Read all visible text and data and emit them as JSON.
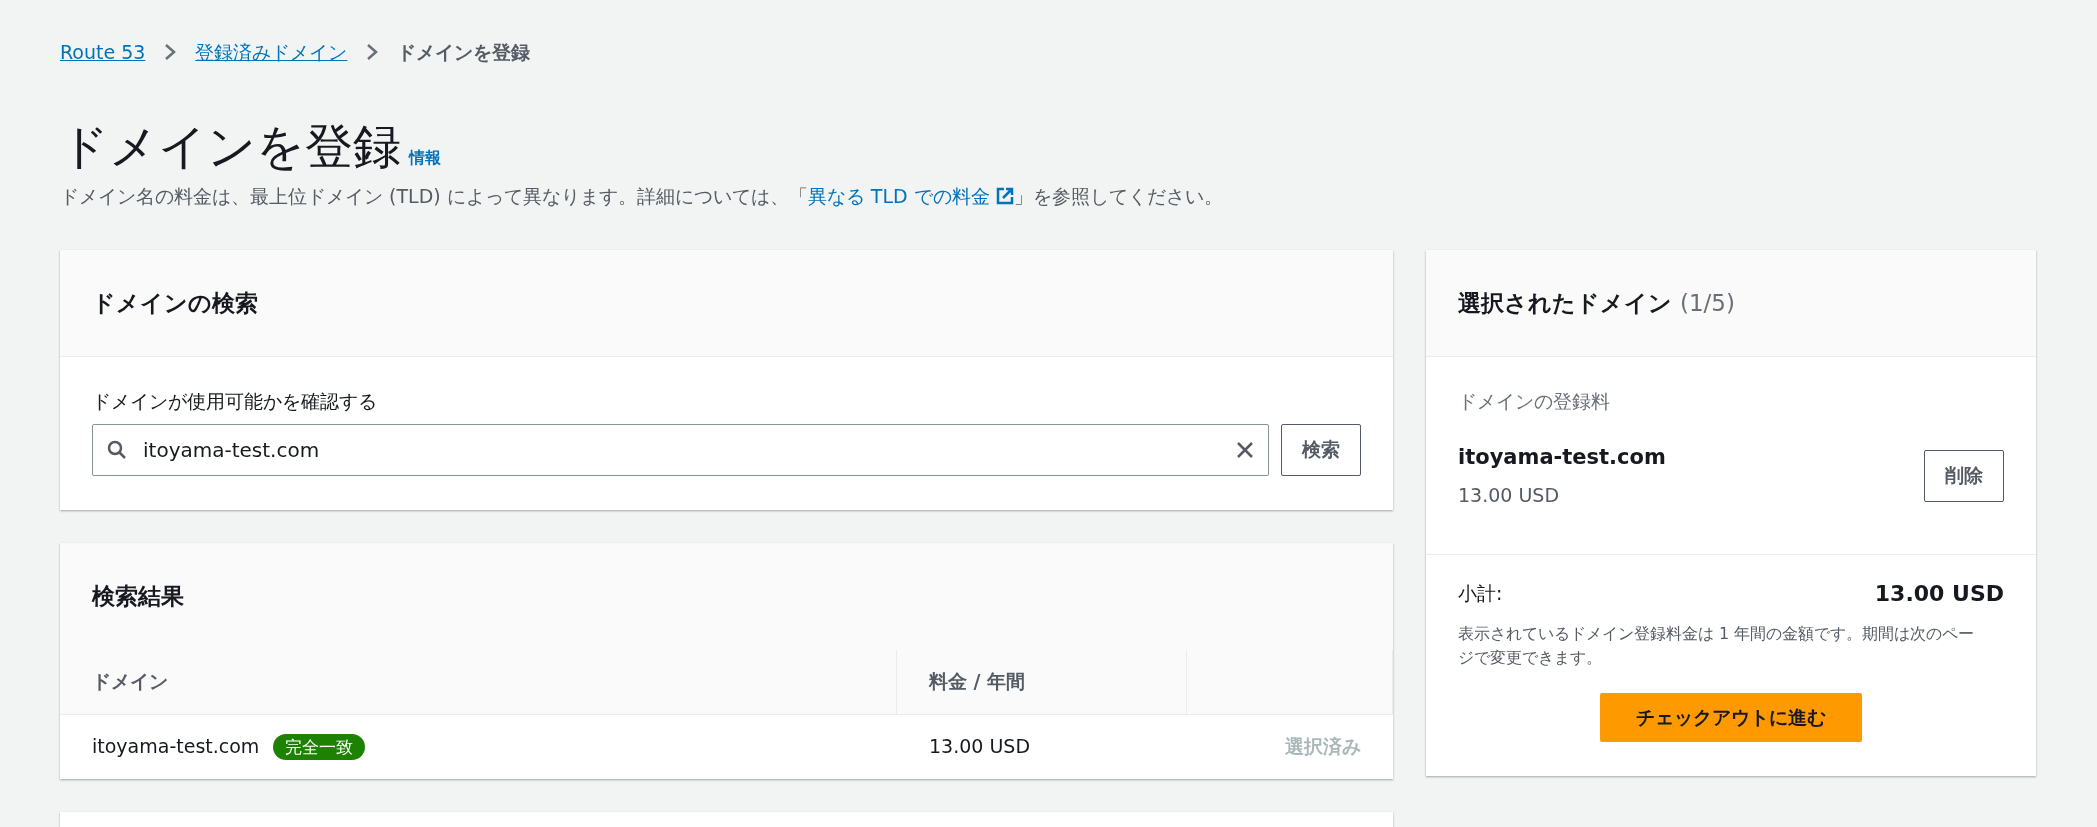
{
  "breadcrumbs": [
    {
      "label": "Route 53",
      "link": true
    },
    {
      "label": "登録済みドメイン",
      "link": true
    },
    {
      "label": "ドメインを登録",
      "link": false
    }
  ],
  "page": {
    "title": "ドメインを登録",
    "info_link": "情報",
    "description_before": "ドメイン名の料金は、最上位ドメイン (TLD) によって異なります。詳細については、「",
    "description_link": "異なる TLD での料金",
    "description_after": "」を参照してください。"
  },
  "search_panel": {
    "title": "ドメインの検索",
    "field_label": "ドメインが使用可能かを確認する",
    "value": "itoyama-test.com",
    "button": "検索"
  },
  "results_panel": {
    "title": "検索結果",
    "columns": [
      "ドメイン",
      "料金 / 年間"
    ],
    "rows": [
      {
        "domain": "itoyama-test.com",
        "badge": "完全一致",
        "price": "13.00 USD",
        "action": "選択済み",
        "disabled": true
      }
    ]
  },
  "selected_panel": {
    "title": "選択されたドメイン",
    "count": "(1/5)",
    "section_label": "ドメインの登録料",
    "items": [
      {
        "domain": "itoyama-test.com",
        "price": "13.00 USD",
        "button": "削除"
      }
    ],
    "subtotal_label": "小計:",
    "subtotal": "13.00 USD",
    "note": "表示されているドメイン登録料金は 1 年間の金額です。期間は次のページで変更できます。",
    "checkout_button": "チェックアウトに進む"
  }
}
